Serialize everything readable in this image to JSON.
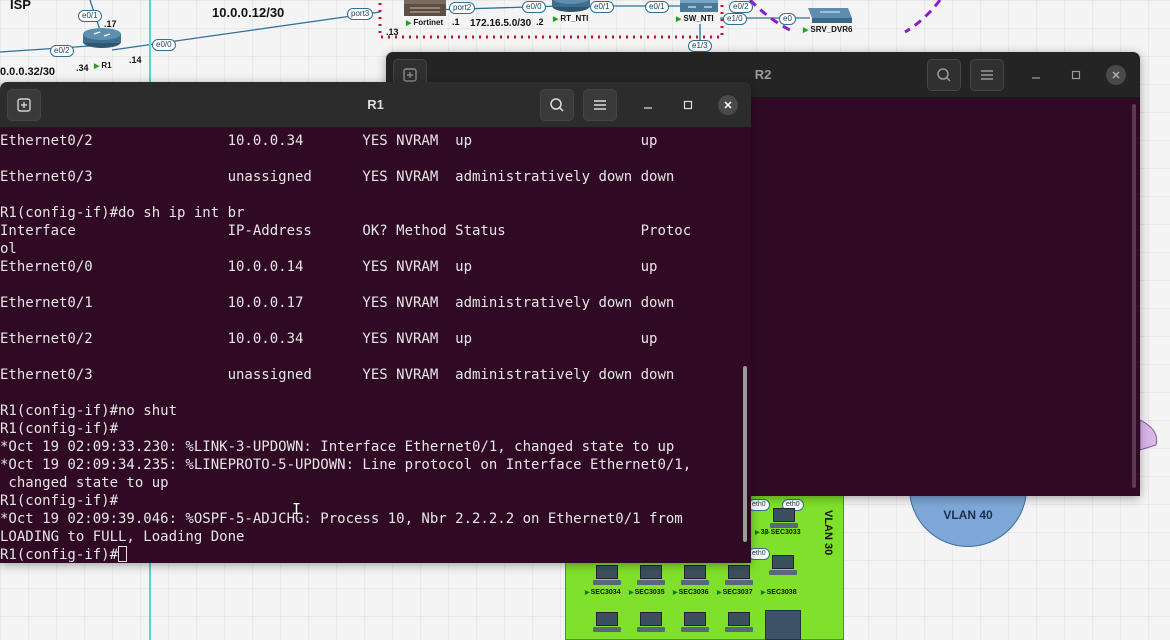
{
  "topology": {
    "isp_label": "ISP",
    "subnet_top": "10.0.0.12/30",
    "subnet_left": "0.0.0.32/30",
    "subnet_fortinet": "172.16.5.0/30",
    "r1": {
      "name": "R1",
      "port_e0_1": "e0/1",
      "port_e0_2": "e0/2",
      "port_e0_0": "e0/0",
      "ip_17": ".17",
      "ip_34": ".34",
      "ip_14": ".14"
    },
    "fortinet": {
      "name": "Fortinet",
      "port3": "port3",
      "port2": "port2",
      "ip_13": ".13",
      "ip_1": ".1"
    },
    "rt_nti": {
      "name": "RT_NTI",
      "port_e0_0": "e0/0",
      "port_e0_1": "e0/1",
      "ip_2": ".2"
    },
    "sw_nti": {
      "name": "SW_NTI",
      "port_e0_1": "e0/1",
      "port_e0_2": "e0/2",
      "port_e1_0": "e1/0",
      "port_e1_3": "e1/3"
    },
    "srv": {
      "name": "SRV_DVR6",
      "port_e0": "e0"
    },
    "vlan40_label": "VLAN 40",
    "vlan30_label": "VLAN 30",
    "pcs_top": [
      "SEC3034",
      "SEC3035",
      "SEC3036",
      "SEC3037",
      "SEC3038"
    ],
    "pc_top_partial": [
      "32",
      "SEC3033"
    ],
    "eth_labels": [
      "eth0",
      "eth0",
      "eth0"
    ],
    "accent_vlan30": "#7fe12b",
    "accent_vlan40": "#7ea7d8"
  },
  "r2_window": {
    "title": "R2",
    "new_tab_icon": "new-tab-icon",
    "search_icon": "search-icon",
    "menu_icon": "hamburger-menu-icon",
    "minimize_icon": "minimize-icon",
    "maximize_icon": "maximize-icon",
    "close_icon": "close-icon",
    "background": "#300a24"
  },
  "r1_window": {
    "title": "R1",
    "new_tab_icon": "new-tab-icon",
    "search_icon": "search-icon",
    "menu_icon": "hamburger-menu-icon",
    "minimize_icon": "minimize-icon",
    "maximize_icon": "maximize-icon",
    "close_icon": "close-icon",
    "background": "#300a24",
    "prompt": "R1(config-if)#",
    "lines": [
      "Ethernet0/2                10.0.0.34       YES NVRAM  up                    up",
      "",
      "Ethernet0/3                unassigned      YES NVRAM  administratively down down",
      "",
      "R1(config-if)#do sh ip int br",
      "Interface                  IP-Address      OK? Method Status                Protoc",
      "ol",
      "Ethernet0/0                10.0.0.14       YES NVRAM  up                    up",
      "",
      "Ethernet0/1                10.0.0.17       YES NVRAM  administratively down down",
      "",
      "Ethernet0/2                10.0.0.34       YES NVRAM  up                    up",
      "",
      "Ethernet0/3                unassigned      YES NVRAM  administratively down down",
      "",
      "R1(config-if)#no shut",
      "R1(config-if)#",
      "*Oct 19 02:09:33.230: %LINK-3-UPDOWN: Interface Ethernet0/1, changed state to up",
      "*Oct 19 02:09:34.235: %LINEPROTO-5-UPDOWN: Line protocol on Interface Ethernet0/1,",
      " changed state to up",
      "R1(config-if)#",
      "*Oct 19 02:09:39.046: %OSPF-5-ADJCHG: Process 10, Nbr 2.2.2.2 on Ethernet0/1 from",
      "LOADING to FULL, Loading Done"
    ]
  }
}
